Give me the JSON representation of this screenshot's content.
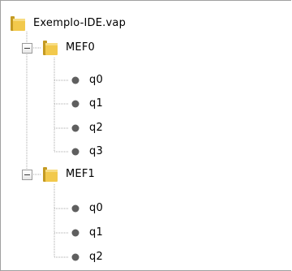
{
  "tree": {
    "root": {
      "label": "Exemplo-IDE.vap",
      "icon": "folder-icon"
    },
    "machines": [
      {
        "label": "MEF0",
        "icon": "folder-icon",
        "expanded": true,
        "expander": "collapse",
        "states": [
          {
            "label": "q0",
            "icon": "state-dot-icon"
          },
          {
            "label": "q1",
            "icon": "state-dot-icon"
          },
          {
            "label": "q2",
            "icon": "state-dot-icon"
          },
          {
            "label": "q3",
            "icon": "state-dot-icon"
          }
        ]
      },
      {
        "label": "MEF1",
        "icon": "folder-icon",
        "expanded": true,
        "expander": "collapse",
        "states": [
          {
            "label": "q0",
            "icon": "state-dot-icon"
          },
          {
            "label": "q1",
            "icon": "state-dot-icon"
          },
          {
            "label": "q2",
            "icon": "state-dot-icon"
          }
        ]
      }
    ]
  },
  "colors": {
    "folder_yellow": "#f2c94c",
    "folder_dark": "#c49a22",
    "state_dot": "#5f5f5f",
    "guide_line": "#a8a8a8",
    "border": "#a0a0a0"
  }
}
